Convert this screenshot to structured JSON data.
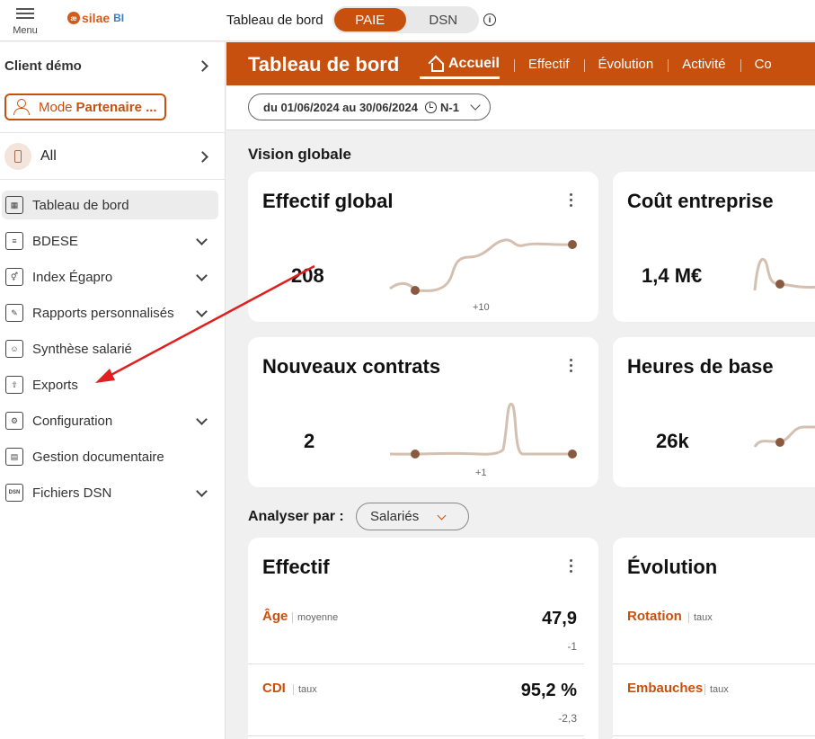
{
  "topbar": {
    "menu_label": "Menu",
    "logo_text": "silae",
    "logo_suffix": "BI",
    "title": "Tableau de bord",
    "toggle": [
      "PAIE",
      "DSN"
    ],
    "toggle_active": "PAIE",
    "info_icon": "i"
  },
  "sidebar": {
    "client": "Client démo",
    "mode_prefix": "Mode",
    "mode_value": "Partenaire ...",
    "all_label": "All",
    "items": [
      {
        "label": "Tableau de bord",
        "icon": "dashboard-icon",
        "glyph": "▦",
        "expandable": false,
        "active": true
      },
      {
        "label": "BDESE",
        "icon": "database-icon",
        "glyph": "≡",
        "expandable": true,
        "active": false
      },
      {
        "label": "Index Égapro",
        "icon": "gender-icon",
        "glyph": "⚥",
        "expandable": true,
        "active": false
      },
      {
        "label": "Rapports personnalisés",
        "icon": "report-edit-icon",
        "glyph": "✎",
        "expandable": true,
        "active": false
      },
      {
        "label": "Synthèse salarié",
        "icon": "employee-file-icon",
        "glyph": "☺",
        "expandable": false,
        "active": false
      },
      {
        "label": "Exports",
        "icon": "export-icon",
        "glyph": "⇧",
        "expandable": false,
        "active": false
      },
      {
        "label": "Configuration",
        "icon": "config-icon",
        "glyph": "⚙",
        "expandable": true,
        "active": false
      },
      {
        "label": "Gestion documentaire",
        "icon": "document-icon",
        "glyph": "▤",
        "expandable": false,
        "active": false
      },
      {
        "label": "Fichiers DSN",
        "icon": "dsn-file-icon",
        "glyph": "DSN",
        "expandable": true,
        "active": false
      }
    ]
  },
  "main": {
    "title": "Tableau de bord",
    "tabs": [
      "Accueil",
      "Effectif",
      "Évolution",
      "Activité",
      "Co"
    ],
    "active_tab": "Accueil",
    "date_range": "du 01/06/2024 au 30/06/2024",
    "comparison": "N-1",
    "section_title": "Vision globale",
    "kpis": [
      {
        "title": "Effectif global",
        "value": "208",
        "delta": "+10"
      },
      {
        "title": "Coût entreprise",
        "value": "1,4 M€",
        "delta": ""
      },
      {
        "title": "Nouveaux contrats",
        "value": "2",
        "delta": "+1"
      },
      {
        "title": "Heures de base",
        "value": "26k",
        "delta": ""
      }
    ],
    "analyse_label": "Analyser par :",
    "analyse_value": "Salariés",
    "effectif_card": {
      "title": "Effectif",
      "rows": [
        {
          "name": "Âge",
          "sub": "moyenne",
          "value": "47,9",
          "delta": "-1"
        },
        {
          "name": "CDI",
          "sub": "taux",
          "value": "95,2 %",
          "delta": "-2,3"
        }
      ]
    },
    "evolution_card": {
      "title": "Évolution",
      "rows": [
        {
          "name": "Rotation",
          "sub": "taux"
        },
        {
          "name": "Embauches",
          "sub": "taux"
        }
      ]
    }
  },
  "colors": {
    "accent": "#c8500e",
    "sparkline": "#d4c0b0",
    "sparkpoint": "#8a5a40",
    "annotation_arrow": "#e02020"
  }
}
